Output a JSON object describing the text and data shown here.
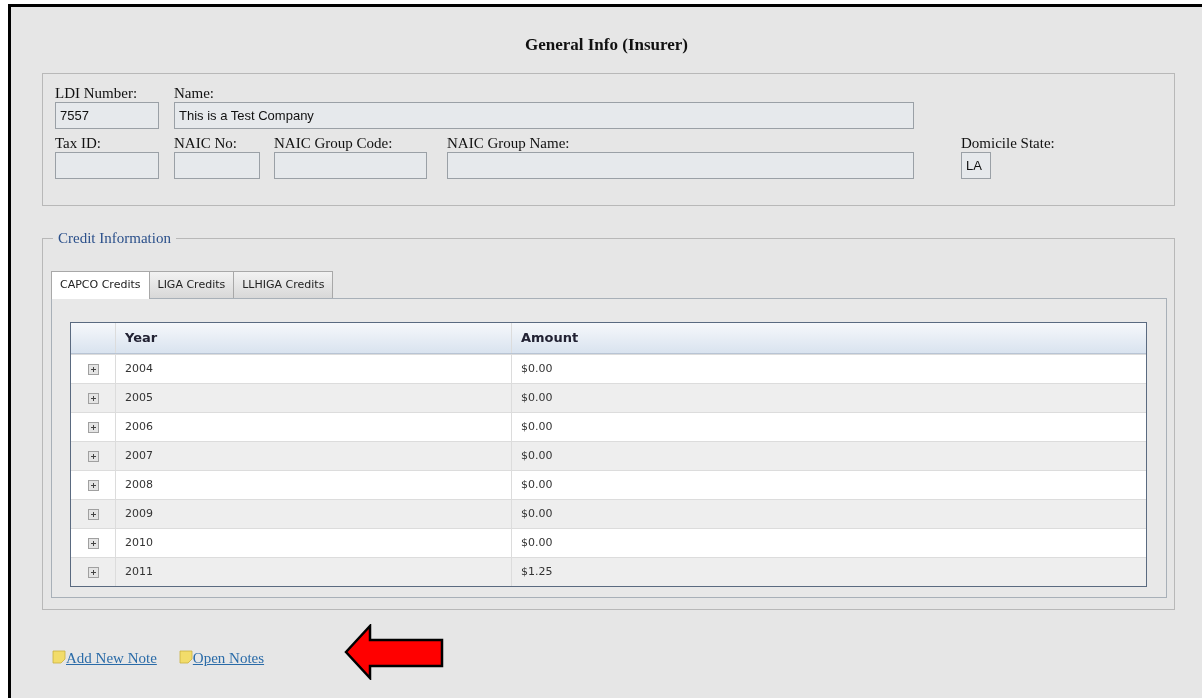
{
  "title": "General Info (Insurer)",
  "insurer_fields": [
    [
      {
        "label": "LDI Number:",
        "value": "7557"
      },
      {
        "label": "Name:",
        "value": "This is a Test Company"
      }
    ],
    [
      {
        "label": "Tax ID:"
      },
      {
        "label": "NAIC No:"
      },
      {
        "label": "NAIC Group Code:"
      },
      {
        "label": "NAIC Group Name:"
      },
      {
        "label": "Domicile State:",
        "value": "LA"
      }
    ]
  ],
  "credit_information": {
    "legend": "Credit Information",
    "tabs": [
      {
        "label": "CAPCO Credits",
        "selected": true
      },
      {
        "label": "LIGA Credits",
        "selected": false
      },
      {
        "label": "LLHIGA Credits",
        "selected": false
      }
    ],
    "table": {
      "columns": [
        "Year",
        "Amount"
      ],
      "rows": [
        {
          "expanded": false,
          "cells": [
            "2004",
            "$0.00"
          ]
        },
        {
          "expanded": false,
          "cells": [
            "2005",
            "$0.00"
          ]
        },
        {
          "expanded": false,
          "cells": [
            "2006",
            "$0.00"
          ]
        },
        {
          "expanded": false,
          "cells": [
            "2007",
            "$0.00"
          ]
        },
        {
          "expanded": false,
          "cells": [
            "2008",
            "$0.00"
          ]
        },
        {
          "expanded": false,
          "cells": [
            "2009",
            "$0.00"
          ]
        },
        {
          "expanded": false,
          "cells": [
            "2010",
            "$0.00"
          ]
        },
        {
          "expanded": false,
          "cells": [
            "2011",
            "$1.25"
          ]
        }
      ]
    }
  },
  "note_links": [
    "Add New Note",
    "Open Notes"
  ]
}
